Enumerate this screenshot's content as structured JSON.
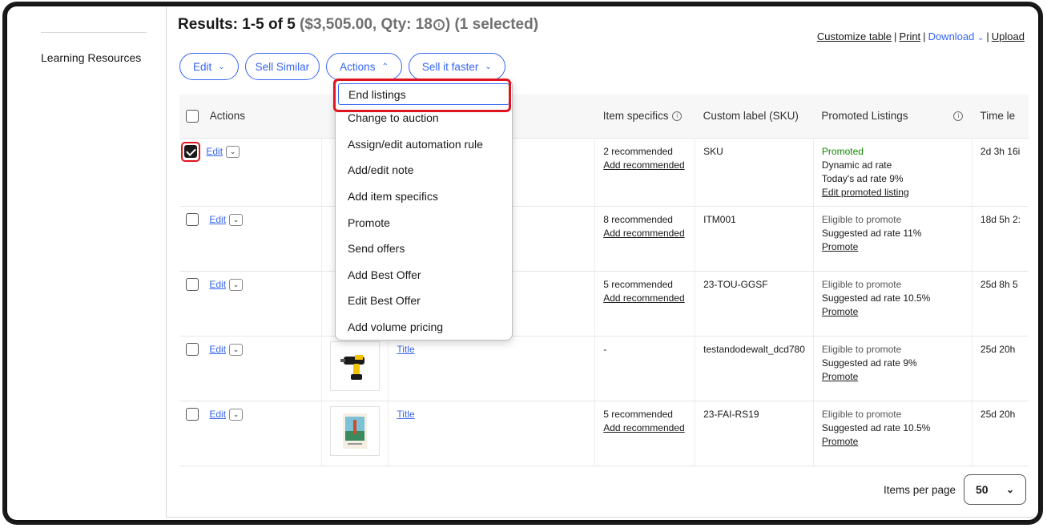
{
  "sidebar": {
    "learning_resources": "Learning Resources"
  },
  "results": {
    "prefix": "Results: 1-5 of 5",
    "summary": "($3,505.00, Qty: 18",
    "info_icon": "info-icon",
    "suffix": ")",
    "selected": "(1 selected)"
  },
  "toplinks": {
    "customize": "Customize table",
    "print": "Print",
    "download": "Download",
    "upload": "Upload"
  },
  "buttons": {
    "edit": "Edit",
    "sell_similar": "Sell Similar",
    "actions": "Actions",
    "sell_faster": "Sell it faster"
  },
  "table": {
    "headers": {
      "actions": "Actions",
      "item_specifics": "Item specifics",
      "custom_label": "Custom label (SKU)",
      "promoted": "Promoted Listings",
      "time_left": "Time le"
    },
    "edit_label": "Edit",
    "rows": [
      {
        "checked": true,
        "title": "",
        "specifics": "2 recommended",
        "add_rec": "Add recommended",
        "sku": "SKU",
        "promo_status": "Promoted",
        "promo_line1": "Dynamic ad rate",
        "promo_line2": "Today's ad rate 9%",
        "promo_link": "Edit promoted listing",
        "time": "2d 3h 16i"
      },
      {
        "checked": false,
        "title": "",
        "specifics": "8 recommended",
        "add_rec": "Add recommended",
        "sku": "ITM001",
        "promo_status": "Eligible to promote",
        "promo_line1": "Suggested ad rate 11%",
        "promo_line2": "",
        "promo_link": "Promote",
        "time": "18d 5h 2:"
      },
      {
        "checked": false,
        "title": "",
        "specifics": "5 recommended",
        "add_rec": "Add recommended",
        "sku": "23-TOU-GGSF",
        "promo_status": "Eligible to promote",
        "promo_line1": "Suggested ad rate 10.5%",
        "promo_line2": "",
        "promo_link": "Promote",
        "time": "25d 8h 5"
      },
      {
        "checked": false,
        "title": "Title",
        "specifics": "-",
        "add_rec": "",
        "sku": "testandodewalt_dcd780",
        "promo_status": "Eligible to promote",
        "promo_line1": "Suggested ad rate 9%",
        "promo_line2": "",
        "promo_link": "Promote",
        "time": "25d 20h"
      },
      {
        "checked": false,
        "title": "Title",
        "specifics": "5 recommended",
        "add_rec": "Add recommended",
        "sku": "23-FAI-RS19",
        "promo_status": "Eligible to promote",
        "promo_line1": "Suggested ad rate 10.5%",
        "promo_line2": "",
        "promo_link": "Promote",
        "time": "25d 20h"
      }
    ]
  },
  "actions_menu": [
    "End listings",
    "Change to auction",
    "Assign/edit automation rule",
    "Add/edit note",
    "Add item specifics",
    "Promote",
    "Send offers",
    "Add Best Offer",
    "Edit Best Offer",
    "Add volume pricing"
  ],
  "pagination": {
    "label": "Items per page",
    "value": "50"
  },
  "colors": {
    "accent": "#3665f3",
    "highlight": "#e0141e",
    "promoted": "#118800"
  }
}
